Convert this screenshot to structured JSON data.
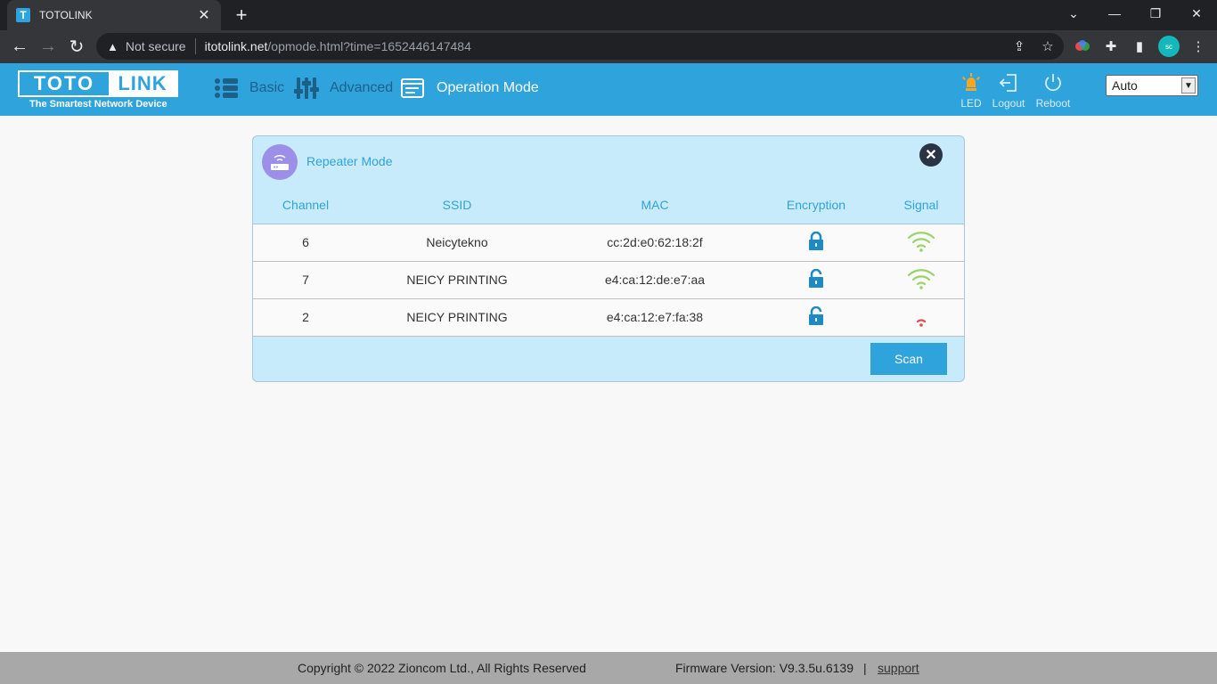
{
  "browser": {
    "tab_title": "TOTOLINK",
    "tab_favicon_letter": "T",
    "tab_close": "✕",
    "new_tab": "+",
    "security_label": "Not secure",
    "url_host": "itotolink.net",
    "url_path": "/opmode.html?time=1652446147484",
    "profile_initial": "sc"
  },
  "header": {
    "logo_left": "TOTO",
    "logo_right": "LINK",
    "tagline": "The Smartest Network Device",
    "menu": [
      {
        "label": "Basic",
        "icon": "list-icon"
      },
      {
        "label": "Advanced",
        "icon": "sliders-icon"
      },
      {
        "label": "Operation Mode",
        "icon": "operation-mode-icon"
      }
    ],
    "tools": [
      {
        "label": "LED",
        "icon": "led-icon",
        "color": "#f5a623"
      },
      {
        "label": "Logout",
        "icon": "logout-icon"
      },
      {
        "label": "Reboot",
        "icon": "power-icon"
      }
    ],
    "language_select": "Auto"
  },
  "panel": {
    "title": "Repeater Mode",
    "columns": [
      "Channel",
      "SSID",
      "MAC",
      "Encryption",
      "Signal"
    ],
    "rows": [
      {
        "channel": "6",
        "ssid": "Neicytekno",
        "mac": "cc:2d:e0:62:18:2f",
        "encryption": "locked",
        "signal": "strong"
      },
      {
        "channel": "7",
        "ssid": "NEICY PRINTING",
        "mac": "e4:ca:12:de:e7:aa",
        "encryption": "unlocked",
        "signal": "strong"
      },
      {
        "channel": "2",
        "ssid": "NEICY PRINTING",
        "mac": "e4:ca:12:e7:fa:38",
        "encryption": "unlocked",
        "signal": "weak"
      }
    ],
    "scan_label": "Scan"
  },
  "footer": {
    "copyright": "Copyright © 2022 Zioncom Ltd., All Rights Reserved",
    "firmware": "Firmware Version: V9.3.5u.6139",
    "separator": "|",
    "support": "support"
  },
  "colors": {
    "brand": "#2fa3dc",
    "panel_bg": "#c8ebfb",
    "signal_strong": "#9ad36a",
    "signal_weak": "#e84a4a",
    "lock": "#1d8ac6"
  }
}
